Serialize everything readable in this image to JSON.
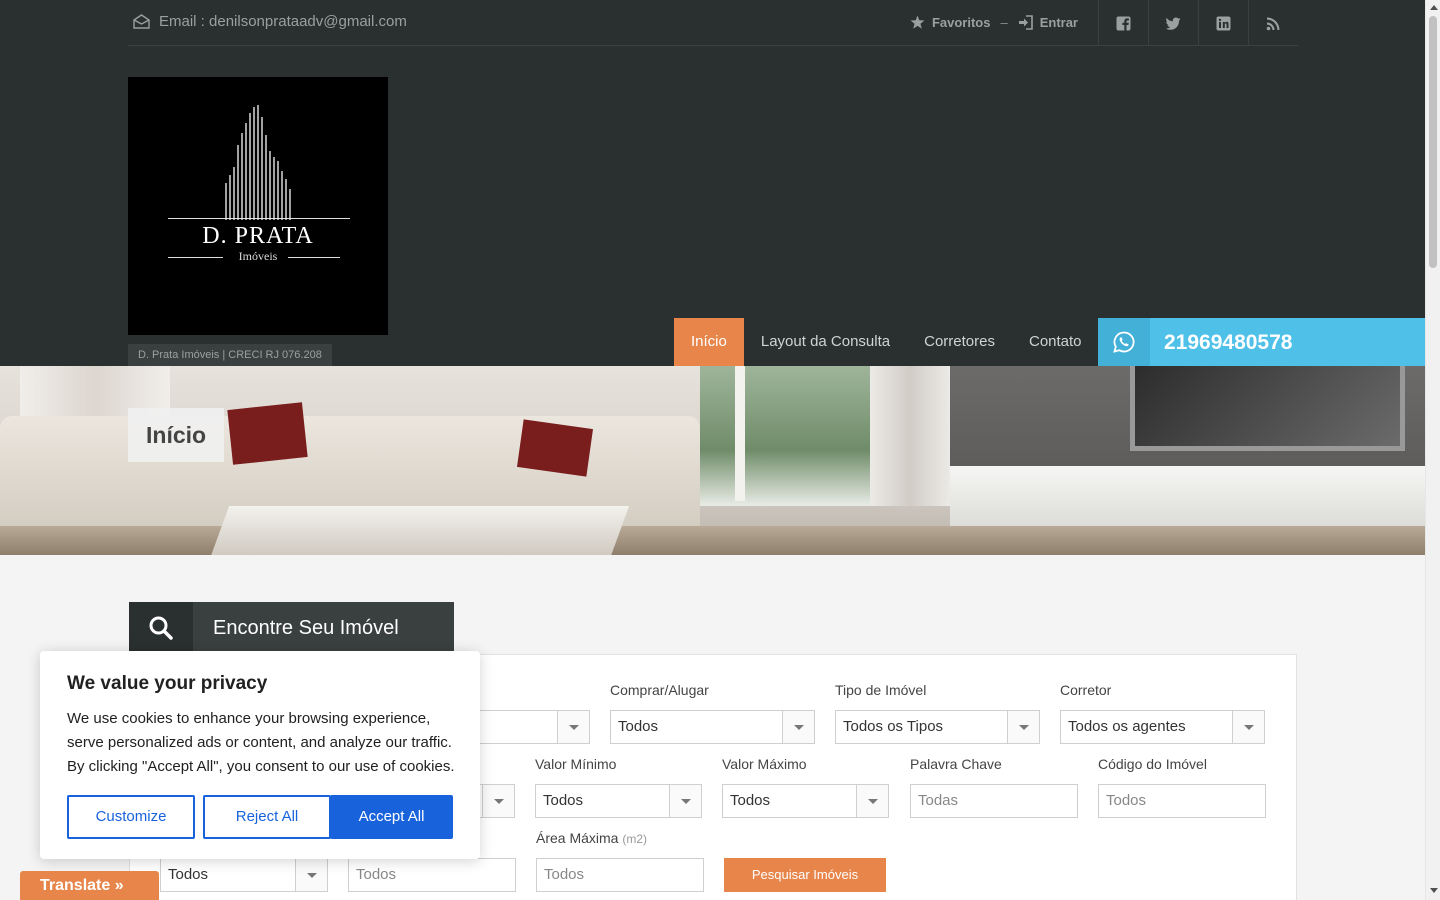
{
  "topbar": {
    "email_label": "Email : denilsonprataadv@gmail.com",
    "favorites_label": "Favoritos",
    "separator": "–",
    "login_label": "Entrar",
    "socials": [
      "facebook-icon",
      "twitter-icon",
      "linkedin-icon",
      "rss-icon"
    ]
  },
  "brand": {
    "logo_name": "D. PRATA",
    "logo_sub": "Imóveis",
    "creci": "D. Prata Imóveis | CRECI RJ 076.208"
  },
  "nav": {
    "items": [
      "Início",
      "Layout da Consulta",
      "Corretores",
      "Contato"
    ],
    "active_index": 0,
    "phone": "21969480578"
  },
  "banner": {
    "title": "Início"
  },
  "search": {
    "title": "Encontre Seu Imóvel",
    "row1": [
      {
        "label": "Comprar/Alugar",
        "value": "Todos"
      },
      {
        "label": "Tipo de Imóvel",
        "value": "Todos os Tipos"
      },
      {
        "label": "Corretor",
        "value": "Todos os agentes"
      }
    ],
    "row2": [
      {
        "label": "Valor Mínimo",
        "value": "Todos"
      },
      {
        "label": "Valor Máximo",
        "value": "Todos"
      },
      {
        "label": "Palavra Chave",
        "placeholder": "Todas"
      },
      {
        "label": "Código do Imóvel",
        "placeholder": "Todos"
      }
    ],
    "row3": {
      "select_value": "Todos",
      "input1_placeholder": "Todos",
      "area_max_label": "Área Máxima",
      "area_max_unit": "(m2)",
      "area_max_placeholder": "Todos"
    },
    "submit_label": "Pesquisar Imóveis"
  },
  "cookie": {
    "title": "We value your privacy",
    "text": "We use cookies to enhance your browsing experience, serve personalized ads or content, and analyze our traffic. By clicking \"Accept All\", you consent to our use of cookies.",
    "customize": "Customize",
    "reject": "Reject All",
    "accept": "Accept All"
  },
  "translate": {
    "label": "Translate »"
  },
  "colors": {
    "accent": "#e8854a",
    "header_bg": "#2a2f2f",
    "phone_bg": "#4fc1e9",
    "cookie_blue": "#1863dc"
  }
}
